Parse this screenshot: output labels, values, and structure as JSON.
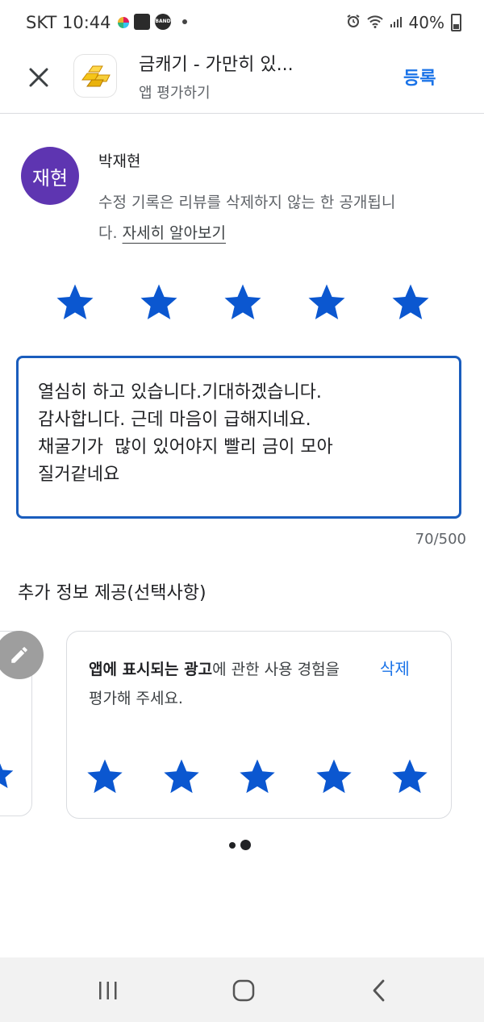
{
  "status_bar": {
    "carrier": "SKT",
    "time": "10:44",
    "band_label": "BAND",
    "battery": "40%"
  },
  "header": {
    "app_title": "금캐기 - 가만히 있...",
    "subtitle": "앱 평가하기",
    "post_label": "등록"
  },
  "author": {
    "avatar_text": "재현",
    "avatar_color": "#5e35b1",
    "name": "박재현",
    "notice": "수정 기록은 리뷰를 삭제하지 않는 한 공개됩니다.",
    "learn_more": "자세히 알아보기"
  },
  "rating": {
    "value": 5,
    "max": 5,
    "star_color": "#0b57d0"
  },
  "review": {
    "text": "열심히 하고 있습니다.기대하겠습니다.\n감사합니다. 근데 마음이 급해지네요.\n채굴기가  많이 있어야지 빨리 금이 모아\n질거같네요",
    "counter": "70/500"
  },
  "extra_section": {
    "title": "추가 정보 제공(선택사항)"
  },
  "ads_card": {
    "highlight": "앱에 표시되는 광고",
    "text_rest": "에 관한 사용 경험을 평가해 주세요.",
    "delete_label": "삭제",
    "rating": 5
  },
  "pager": {
    "count": 2,
    "active": 1
  },
  "nav": {
    "icons": [
      "recent-apps-icon",
      "home-icon",
      "back-icon"
    ]
  }
}
